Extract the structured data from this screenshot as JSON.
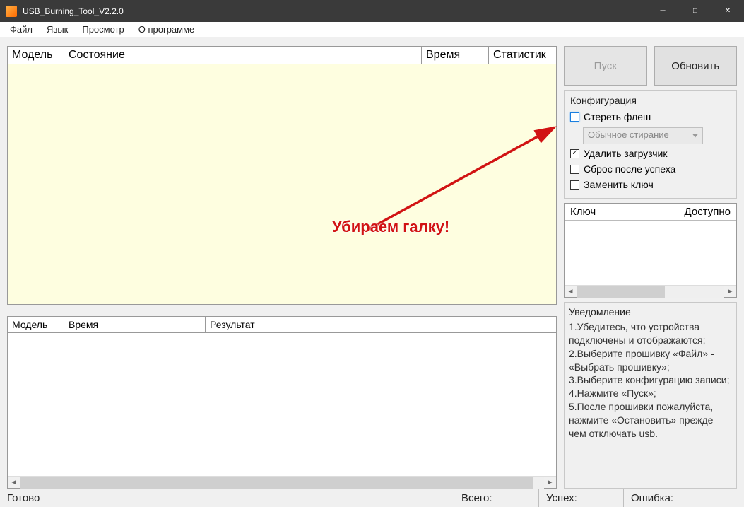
{
  "title": "USB_Burning_Tool_V2.2.0",
  "menu": {
    "file": "Файл",
    "lang": "Язык",
    "view": "Просмотр",
    "about": "О программе"
  },
  "grid1": {
    "model": "Модель",
    "status": "Состояние",
    "time": "Время",
    "stats": "Статистик"
  },
  "grid2": {
    "model": "Модель",
    "time": "Время",
    "result": "Результат"
  },
  "buttons": {
    "start": "Пуск",
    "refresh": "Обновить"
  },
  "config": {
    "title": "Конфигурация",
    "erase_flash": "Стереть флеш",
    "erase_mode": "Обычное стирание",
    "erase_bootloader": "Удалить загрузчик",
    "reset_after": "Сброс после успеха",
    "replace_key": "Заменить ключ"
  },
  "keys": {
    "key": "Ключ",
    "available": "Доступно"
  },
  "notify": {
    "title": "Уведомление",
    "l1": "1.Убедитесь, что устройства подключены и отображаются;",
    "l2": "2.Выберите прошивку «Файл» - «Выбрать прошивку»;",
    "l3": "3.Выберите конфигурацию записи;",
    "l4": "4.Нажмите «Пуск»;",
    "l5": "5.После прошивки пожалуйста, нажмите «Остановить» прежде чем отключать usb."
  },
  "status": {
    "ready": "Готово",
    "total": "Всего:",
    "success": "Успех:",
    "error": "Ошибка:"
  },
  "annotation": "Убираем галку!"
}
